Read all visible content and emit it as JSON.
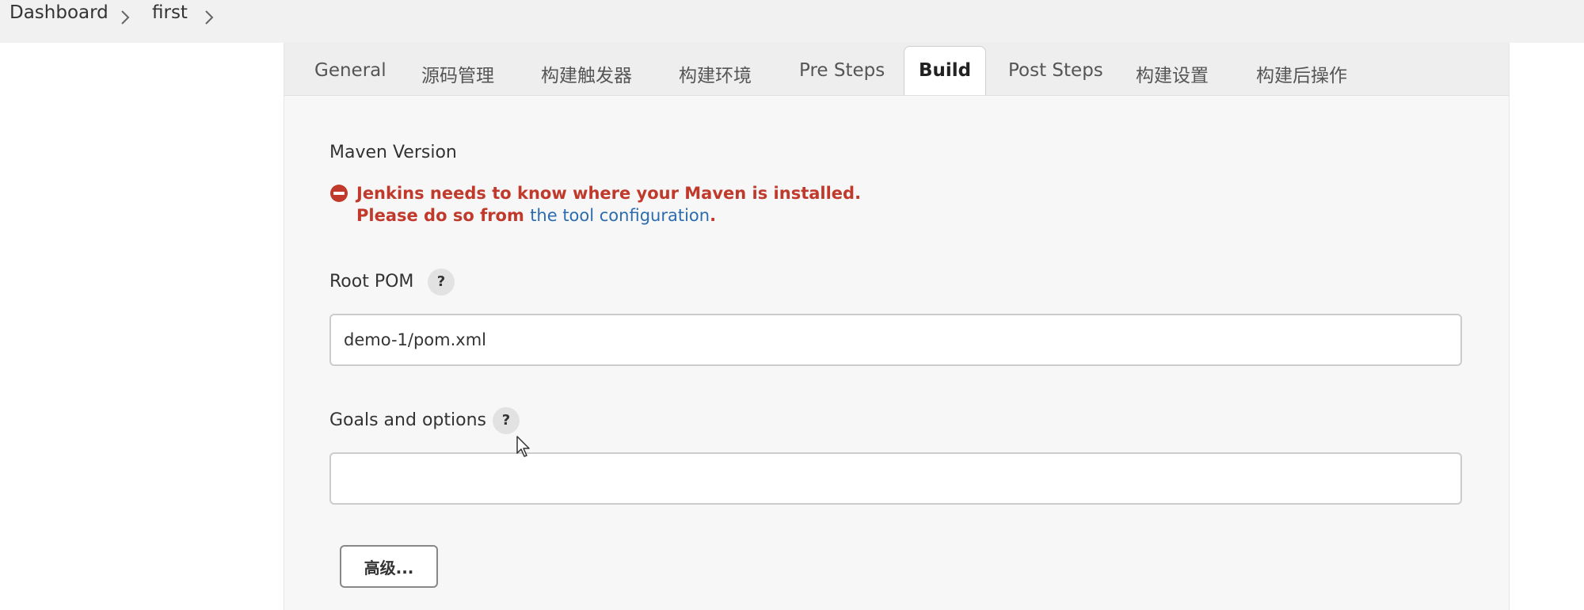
{
  "breadcrumb": {
    "items": [
      "Dashboard",
      "first"
    ]
  },
  "tabs": [
    {
      "label": "General"
    },
    {
      "label": "源码管理"
    },
    {
      "label": "构建触发器"
    },
    {
      "label": "构建环境"
    },
    {
      "label": "Pre Steps"
    },
    {
      "label": "Build",
      "active": true
    },
    {
      "label": "Post Steps"
    },
    {
      "label": "构建设置"
    },
    {
      "label": "构建后操作"
    }
  ],
  "build": {
    "maven_version_label": "Maven Version",
    "error": {
      "line1": "Jenkins needs to know where your Maven is installed.",
      "line2_prefix": "Please do so from ",
      "link_text": "the tool configuration",
      "line2_suffix": "."
    },
    "root_pom": {
      "label": "Root POM",
      "help": "?",
      "value": "demo-1/pom.xml"
    },
    "goals": {
      "label": "Goals and options",
      "help": "?",
      "value": ""
    },
    "advanced_button": "高级..."
  },
  "icons": {
    "error": "no-entry-icon",
    "chevron": "chevron-right-icon",
    "help": "question-icon",
    "cursor": "mouse-pointer-icon"
  },
  "colors": {
    "error_text": "#c0392b",
    "link": "#2b6cb0",
    "panel_bg": "#f7f7f7",
    "breadcrumb_bg": "#f1f1f1"
  }
}
